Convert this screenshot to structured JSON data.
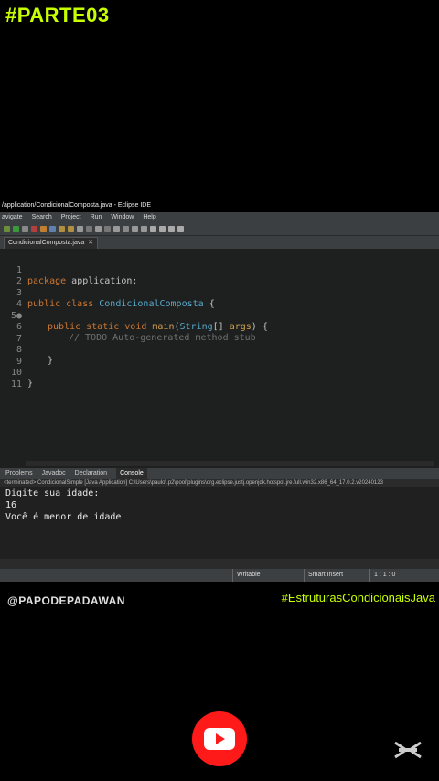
{
  "top_tag": "#PARTE03",
  "window": {
    "title": "/application/CondicionalComposta.java - Eclipse IDE",
    "menu": [
      "avigate",
      "Search",
      "Project",
      "Run",
      "Window",
      "Help"
    ]
  },
  "editor": {
    "tab_label": "CondicionalComposta.java",
    "tab_close": "✕",
    "line_numbers": [
      "1",
      "2",
      "3",
      "4",
      "5●",
      "6",
      "7",
      "8",
      "9",
      "10",
      "11"
    ]
  },
  "code": {
    "l1_kw": "package",
    "l1_rest": " application;",
    "l3_kw": "public class",
    "l3_cls": " CondicionalComposta",
    "l3_rest": " {",
    "l5_kw": "public static void",
    "l5_fn": " main",
    "l5_p1": "(",
    "l5_type": "String",
    "l5_p2": "[] ",
    "l5_arg": "args",
    "l5_p3": ") {",
    "l6_cmt": "// TODO Auto-generated method stub",
    "l8": "}",
    "l10": "}"
  },
  "bottom_panel": {
    "tabs": [
      "Problems",
      "Javadoc",
      "Declaration",
      "Console"
    ],
    "console_path": "<terminated> CondicionalSimple [Java Application] C:\\Users\\paulo\\.p2\\pool\\plugins\\org.eclipse.justj.openjdk.hotspot.jre.full.win32.x86_64_17.0.2.v20240123",
    "console_lines": [
      "Digite sua idade:",
      "16",
      "Você é menor de idade"
    ]
  },
  "status": {
    "writable": "Writable",
    "insert": "Smart Insert",
    "position": "1 : 1 : 0"
  },
  "overlay": {
    "handle": "@PAPODEPADAWAN",
    "hashtag": "#EstruturasCondicionaisJava"
  },
  "colors": {
    "accent": "#c8ff00",
    "youtube": "#ff1a1a"
  }
}
